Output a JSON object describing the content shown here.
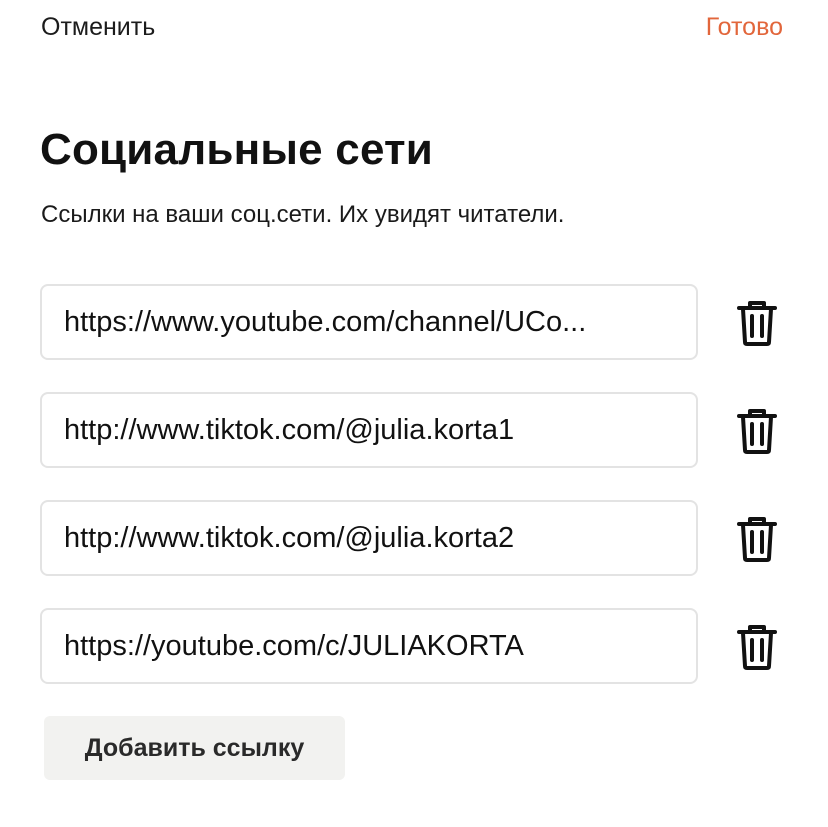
{
  "header": {
    "cancel_label": "Отменить",
    "done_label": "Готово"
  },
  "page": {
    "title": "Социальные сети",
    "subtitle": "Ссылки на ваши соц.сети. Их увидят читатели."
  },
  "links": [
    {
      "value": "https://www.youtube.com/channel/UCo..."
    },
    {
      "value": "http://www.tiktok.com/@julia.korta1"
    },
    {
      "value": "http://www.tiktok.com/@julia.korta2"
    },
    {
      "value": "https://youtube.com/c/JULIAKORTA"
    }
  ],
  "add_button_label": "Добавить ссылку",
  "icons": {
    "delete": "trash-icon"
  },
  "colors": {
    "accent": "#e2663b",
    "text": "#111111",
    "input_border": "#e3e3e3",
    "add_button_bg": "#f2f2f0"
  }
}
